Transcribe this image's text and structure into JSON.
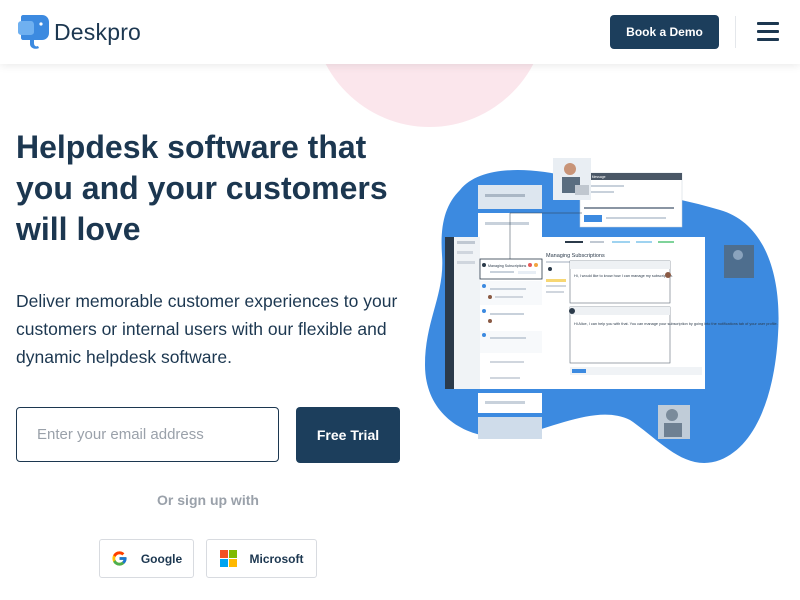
{
  "header": {
    "logo_text": "Deskpro",
    "logo_icon": "deskpro-elephant-icon",
    "book_demo_label": "Book a Demo",
    "menu_icon": "hamburger-menu-icon"
  },
  "hero": {
    "headline": "Helpdesk software that you and your customers will love",
    "subtext": "Deliver memorable customer experiences to your customers or internal users with our flexible and dynamic helpdesk software.",
    "email_placeholder": "Enter your email address",
    "email_value": "",
    "free_trial_label": "Free Trial",
    "or_sign_up": "Or sign up with",
    "google_label": "Google",
    "microsoft_label": "Microsoft"
  },
  "mockup": {
    "panel_title": "Managing Subscriptions",
    "ticket_subject": "Managing Subscriptions",
    "compose_title": "New Message",
    "message_1": "Hi, I would like to know how I can manage my subscription.",
    "message_2": "Hi Alice, I can help you with that. You can manage your subscription by going into the notifications tab of your user profile.",
    "reply_label": "Reply"
  },
  "colors": {
    "brand_dark": "#1c3e5c",
    "text_dark": "#1c3750",
    "accent_blue": "#3c8ae0",
    "blob_pink": "#fbe6ec"
  }
}
